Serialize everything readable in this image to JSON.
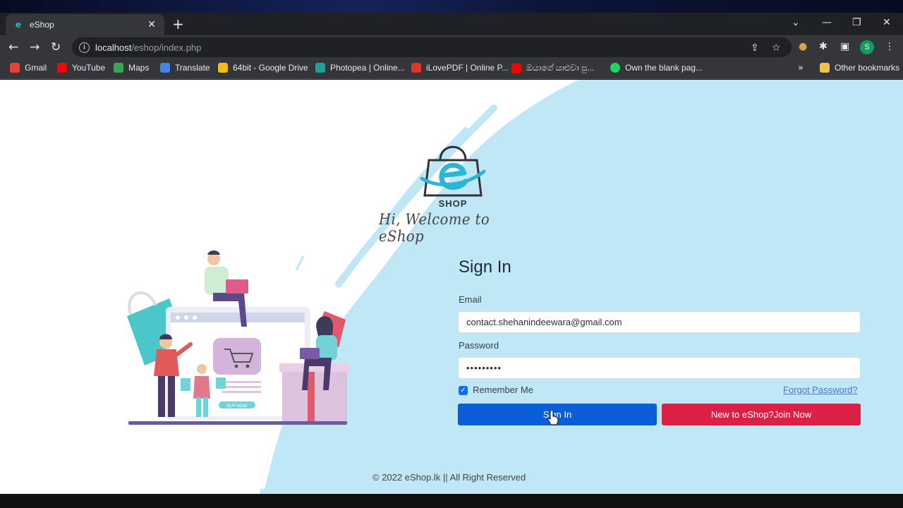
{
  "browser": {
    "tab_title": "eShop",
    "tab_favicon": "e",
    "tab_close_glyph": "✕",
    "new_tab_glyph": "+",
    "tab_search_glyph": "⌄",
    "minimize_glyph": "—",
    "restore_glyph": "❐",
    "close_glyph": "✕",
    "back_glyph": "←",
    "forward_glyph": "→",
    "reload_glyph": "↻",
    "info_glyph": "i",
    "url_host": "localhost",
    "url_path": "/eshop/index.php",
    "share_glyph": "⇪",
    "star_glyph": "☆",
    "cookie_glyph": "●",
    "extensions_glyph": "✱",
    "sidepanel_glyph": "▣",
    "profile_initial": "S",
    "menu_glyph": "⋮",
    "more_bookmarks_glyph": "»",
    "bookmarks": [
      {
        "label": "Gmail",
        "color": "#ea4335"
      },
      {
        "label": "YouTube",
        "color": "#ff0000"
      },
      {
        "label": "Maps",
        "color": "#34a853"
      },
      {
        "label": "Translate",
        "color": "#4285f4"
      },
      {
        "label": "64bit - Google Drive",
        "color": "#fbbc04"
      },
      {
        "label": "Photopea | Online...",
        "color": "#18a497"
      },
      {
        "label": "iLovePDF | Online P...",
        "color": "#e5322d"
      },
      {
        "label": "ඔයාගේ යාළුවා පු...",
        "color": "#ff0000"
      },
      {
        "label": "Own the blank pag...",
        "color": "#1ed760"
      }
    ],
    "other_bookmarks": "Other bookmarks"
  },
  "page": {
    "logo_text": "SHOP",
    "welcome": "Hi, Welcome to eShop",
    "signin_title": "Sign In",
    "email_label": "Email",
    "email_value": "contact.shehanindeewara@gmail.com",
    "password_label": "Password",
    "password_value": "•••••••••",
    "remember_label": "Remember Me",
    "remember_checked_glyph": "✓",
    "forgot_label": "Forgot Password?",
    "signin_button": "Sign In",
    "join_button": "New to eShop?Join Now",
    "illustration_button": "BUY NOW",
    "footer": "© 2022 eShop.lk || All Right Reserved"
  },
  "colors": {
    "primary": "#0b5ed7",
    "danger": "#dc1f44",
    "accent_light_blue": "#bfe7f5",
    "logo_blue": "#2cb5d8"
  }
}
